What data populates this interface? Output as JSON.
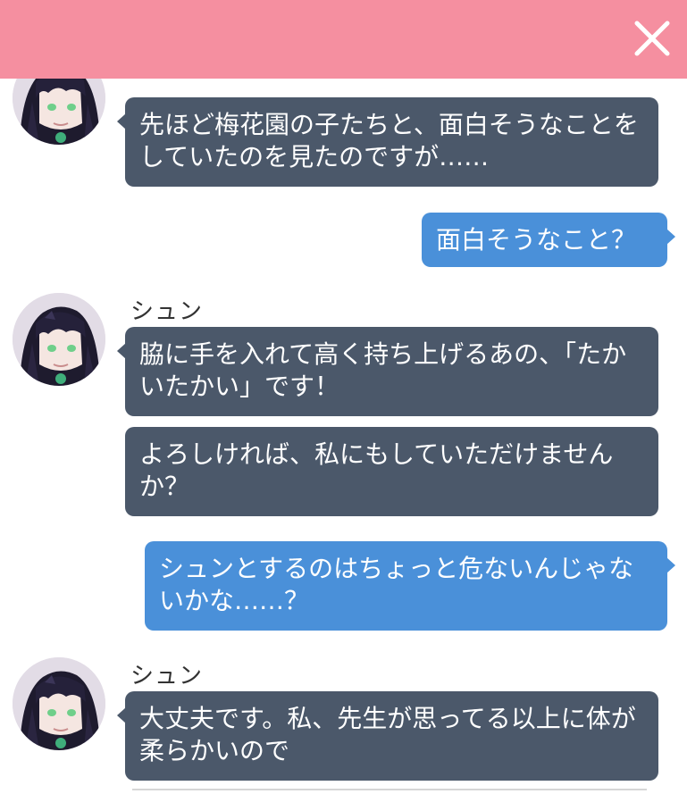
{
  "header": {
    "close_icon": "close-icon",
    "color": "#f58fa0"
  },
  "colors": {
    "student_bubble": "#4b586a",
    "sensei_bubble": "#4a90d9"
  },
  "messages": [
    {
      "sender": "",
      "side": "left",
      "avatar": "shun-avatar",
      "text": "先ほど梅花園の子たちと、面白そうなことをしていたのを見たのですが……"
    },
    {
      "sender": "",
      "side": "right",
      "text": "面白そうなこと？"
    },
    {
      "sender": "シュン",
      "side": "left",
      "avatar": "shun-avatar",
      "text": "脇に手を入れて高く持ち上げるあの、「たかいたかい」です！"
    },
    {
      "sender": "",
      "side": "left",
      "text": "よろしければ、私にもしていただけませんか？"
    },
    {
      "sender": "",
      "side": "right",
      "text": "シュンとするのはちょっと危ないんじゃないかな……？"
    },
    {
      "sender": "シュン",
      "side": "left",
      "avatar": "shun-avatar",
      "text": "大丈夫です。私、先生が思ってる以上に体が柔らかいので"
    }
  ]
}
